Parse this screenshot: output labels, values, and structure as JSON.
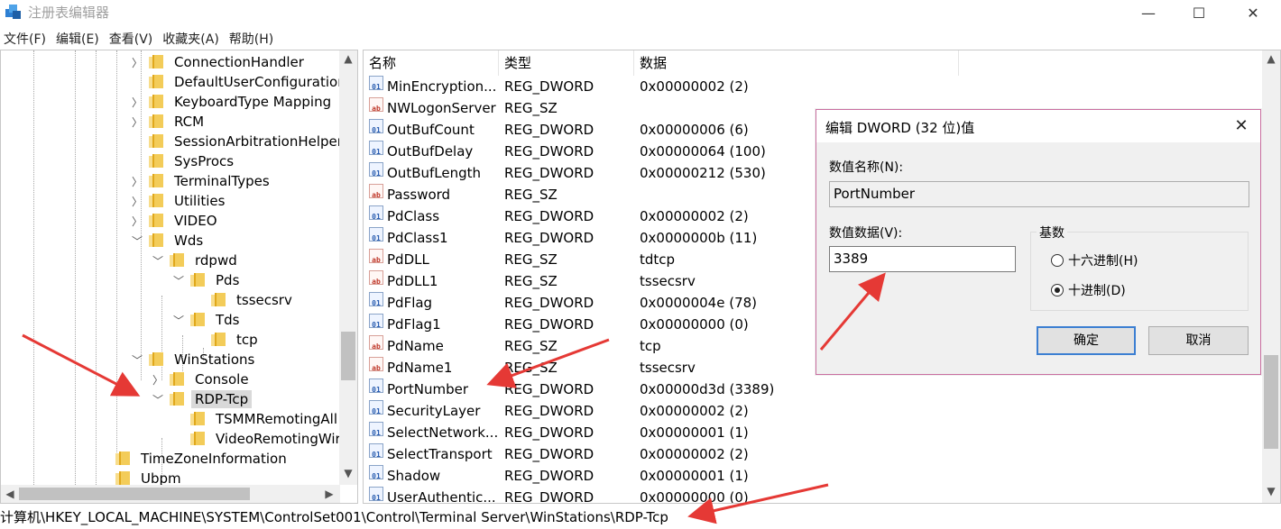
{
  "window": {
    "title": "注册表编辑器",
    "minimize_glyph": "—",
    "maximize_glyph": "☐",
    "close_glyph": "✕"
  },
  "menu": [
    "文件(F)",
    "编辑(E)",
    "查看(V)",
    "收藏夹(A)",
    "帮助(H)"
  ],
  "tree": [
    {
      "label": "ConnectionHandler",
      "depth": 0,
      "expander": "collapsed"
    },
    {
      "label": "DefaultUserConfiguration",
      "depth": 0,
      "expander": "none"
    },
    {
      "label": "KeyboardType Mapping",
      "depth": 0,
      "expander": "collapsed"
    },
    {
      "label": "RCM",
      "depth": 0,
      "expander": "collapsed"
    },
    {
      "label": "SessionArbitrationHelper",
      "depth": 0,
      "expander": "none"
    },
    {
      "label": "SysProcs",
      "depth": 0,
      "expander": "none"
    },
    {
      "label": "TerminalTypes",
      "depth": 0,
      "expander": "collapsed"
    },
    {
      "label": "Utilities",
      "depth": 0,
      "expander": "collapsed"
    },
    {
      "label": "VIDEO",
      "depth": 0,
      "expander": "collapsed"
    },
    {
      "label": "Wds",
      "depth": 0,
      "expander": "expanded"
    },
    {
      "label": "rdpwd",
      "depth": 1,
      "expander": "expanded"
    },
    {
      "label": "Pds",
      "depth": 2,
      "expander": "expanded"
    },
    {
      "label": "tssecsrv",
      "depth": 3,
      "expander": "none"
    },
    {
      "label": "Tds",
      "depth": 2,
      "expander": "expanded"
    },
    {
      "label": "tcp",
      "depth": 3,
      "expander": "none"
    },
    {
      "label": "WinStations",
      "depth": 0,
      "expander": "expanded"
    },
    {
      "label": "Console",
      "depth": 1,
      "expander": "collapsed"
    },
    {
      "label": "RDP-Tcp",
      "depth": 1,
      "expander": "expanded",
      "selected": true
    },
    {
      "label": "TSMMRemotingAll",
      "depth": 2,
      "expander": "none"
    },
    {
      "label": "VideoRemotingWir",
      "depth": 2,
      "expander": "none"
    },
    {
      "label": "TimeZoneInformation",
      "depth": -1,
      "expander": "none"
    },
    {
      "label": "Ubpm",
      "depth": -1,
      "expander": "none"
    }
  ],
  "list": {
    "columns": [
      "名称",
      "类型",
      "数据"
    ],
    "rows": [
      {
        "name": "MinEncryption...",
        "type": "REG_DWORD",
        "data": "0x00000002 (2)",
        "icon": "binary-value-icon"
      },
      {
        "name": "NWLogonServer",
        "type": "REG_SZ",
        "data": "",
        "icon": "string-value-icon"
      },
      {
        "name": "OutBufCount",
        "type": "REG_DWORD",
        "data": "0x00000006 (6)",
        "icon": "binary-value-icon"
      },
      {
        "name": "OutBufDelay",
        "type": "REG_DWORD",
        "data": "0x00000064 (100)",
        "icon": "binary-value-icon"
      },
      {
        "name": "OutBufLength",
        "type": "REG_DWORD",
        "data": "0x00000212 (530)",
        "icon": "binary-value-icon"
      },
      {
        "name": "Password",
        "type": "REG_SZ",
        "data": "",
        "icon": "string-value-icon"
      },
      {
        "name": "PdClass",
        "type": "REG_DWORD",
        "data": "0x00000002 (2)",
        "icon": "binary-value-icon"
      },
      {
        "name": "PdClass1",
        "type": "REG_DWORD",
        "data": "0x0000000b (11)",
        "icon": "binary-value-icon"
      },
      {
        "name": "PdDLL",
        "type": "REG_SZ",
        "data": "tdtcp",
        "icon": "string-value-icon"
      },
      {
        "name": "PdDLL1",
        "type": "REG_SZ",
        "data": "tssecsrv",
        "icon": "string-value-icon"
      },
      {
        "name": "PdFlag",
        "type": "REG_DWORD",
        "data": "0x0000004e (78)",
        "icon": "binary-value-icon"
      },
      {
        "name": "PdFlag1",
        "type": "REG_DWORD",
        "data": "0x00000000 (0)",
        "icon": "binary-value-icon"
      },
      {
        "name": "PdName",
        "type": "REG_SZ",
        "data": "tcp",
        "icon": "string-value-icon"
      },
      {
        "name": "PdName1",
        "type": "REG_SZ",
        "data": "tssecsrv",
        "icon": "string-value-icon"
      },
      {
        "name": "PortNumber",
        "type": "REG_DWORD",
        "data": "0x00000d3d (3389)",
        "icon": "binary-value-icon"
      },
      {
        "name": "SecurityLayer",
        "type": "REG_DWORD",
        "data": "0x00000002 (2)",
        "icon": "binary-value-icon"
      },
      {
        "name": "SelectNetwork...",
        "type": "REG_DWORD",
        "data": "0x00000001 (1)",
        "icon": "binary-value-icon"
      },
      {
        "name": "SelectTransport",
        "type": "REG_DWORD",
        "data": "0x00000002 (2)",
        "icon": "binary-value-icon"
      },
      {
        "name": "Shadow",
        "type": "REG_DWORD",
        "data": "0x00000001 (1)",
        "icon": "binary-value-icon"
      },
      {
        "name": "UserAuthentic...",
        "type": "REG_DWORD",
        "data": "0x00000000 (0)",
        "icon": "binary-value-icon"
      }
    ]
  },
  "status": {
    "path": "计算机\\HKEY_LOCAL_MACHINE\\SYSTEM\\ControlSet001\\Control\\Terminal Server\\WinStations\\RDP-Tcp"
  },
  "dialog": {
    "title": "编辑 DWORD (32 位)值",
    "close_glyph": "✕",
    "name_label": "数值名称(N):",
    "name_value": "PortNumber",
    "data_label": "数值数据(V):",
    "data_value": "3389",
    "base_label": "基数",
    "radio_hex": "十六进制(H)",
    "radio_dec": "十进制(D)",
    "selected_base": "decimal",
    "ok_label": "确定",
    "cancel_label": "取消"
  },
  "annotation_color": "#e53935"
}
